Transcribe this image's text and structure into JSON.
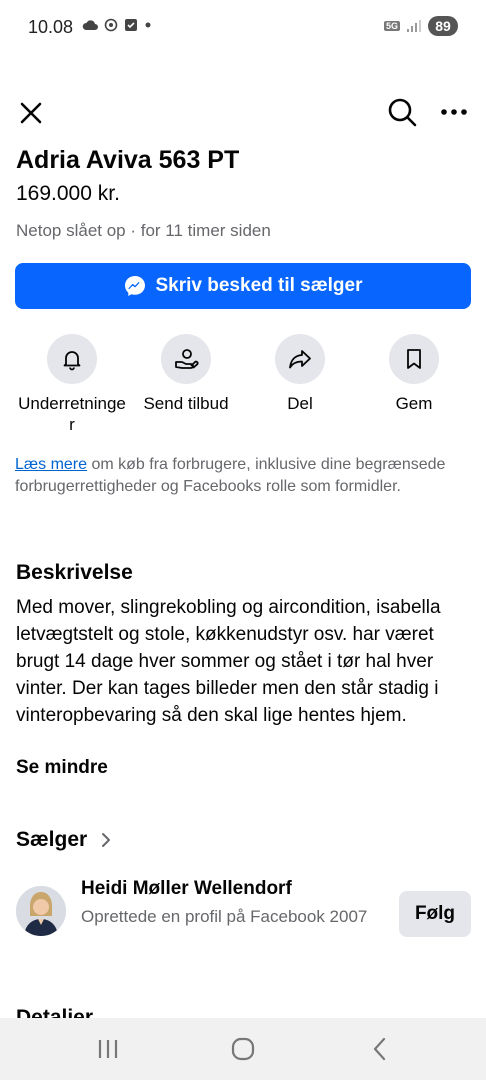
{
  "status": {
    "time": "10.08",
    "battery": "89",
    "network": "5G"
  },
  "listing": {
    "title": "Adria Aviva 563 PT",
    "price": "169.000 kr.",
    "listed": "Netop slået op · for 11 timer siden",
    "message_button": "Skriv besked til sælger"
  },
  "actions": [
    {
      "label": "Underretninger",
      "icon": "bell-icon"
    },
    {
      "label": "Send tilbud",
      "icon": "offer-icon"
    },
    {
      "label": "Del",
      "icon": "share-icon"
    },
    {
      "label": "Gem",
      "icon": "bookmark-icon"
    }
  ],
  "legal": {
    "link": "Læs mere",
    "text": " om køb fra forbrugere, inklusive dine begrænsede forbrugerrettigheder og Facebooks rolle som formidler."
  },
  "description": {
    "heading": "Beskrivelse",
    "body": "Med mover, slingrekobling og aircondition, isabella letvægtstelt og stole, køkkenudstyr osv. har været brugt 14 dage hver sommer og stået i tør hal hver vinter. Der kan tages billeder men den står stadig i vinteropbevaring så den skal lige hentes hjem.",
    "see_less": "Se mindre"
  },
  "seller": {
    "heading": "Sælger",
    "name": "Heidi Møller Wellendorf",
    "subtitle": "Oprettede en profil på Facebook 2007",
    "follow": "Følg"
  },
  "details": {
    "heading": "Detaljer"
  },
  "colors": {
    "accent": "#0866ff",
    "secondary_text": "#65676b",
    "chip_bg": "#e4e6eb"
  }
}
